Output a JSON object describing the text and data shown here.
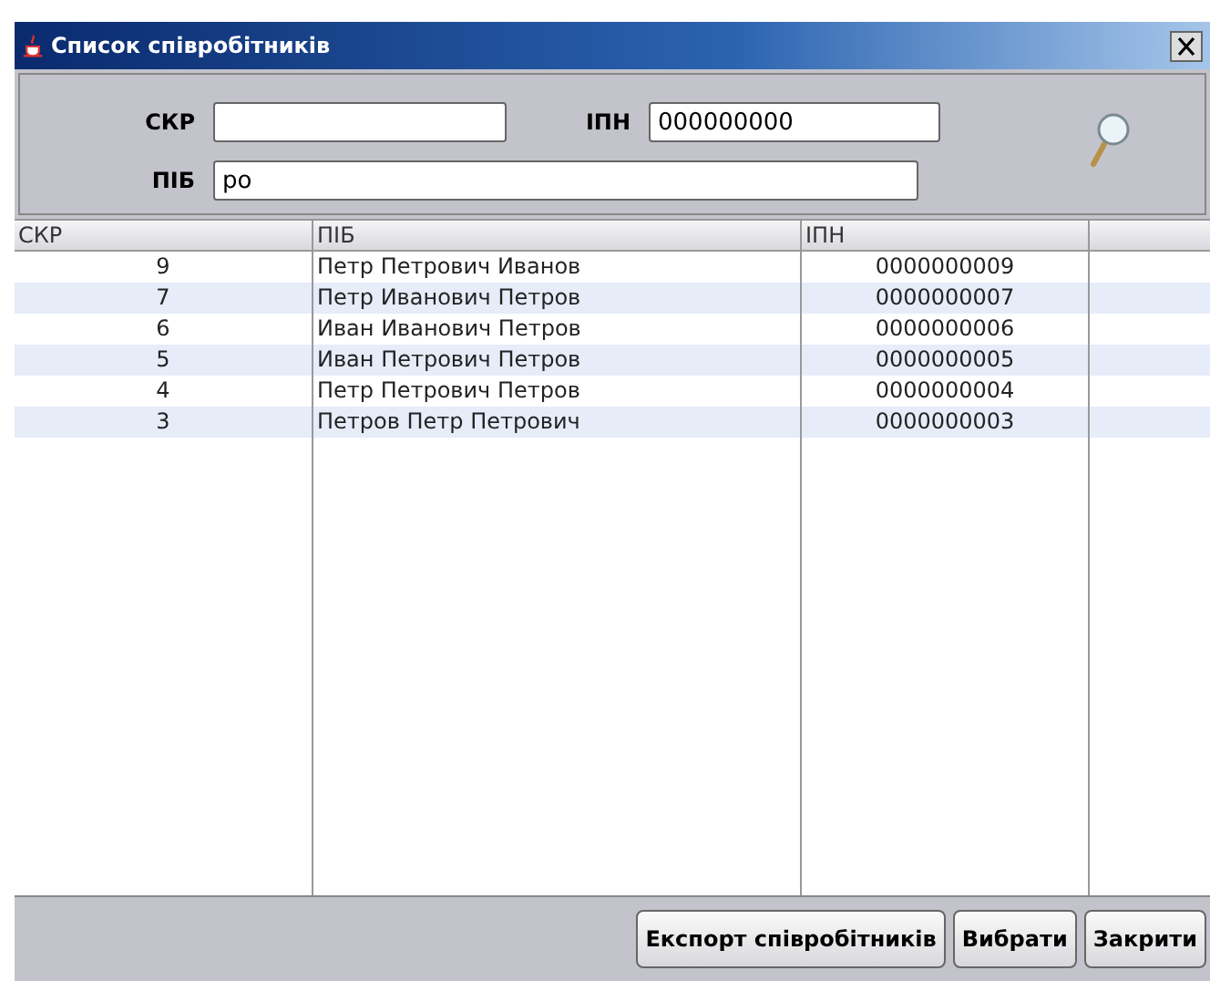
{
  "window": {
    "title": "Список співробітників"
  },
  "form": {
    "fields": [
      {
        "label": "СКР"
      },
      {
        "label": "ІПН",
        "value": "000000000"
      },
      {
        "label": "ПІБ",
        "value": "ро"
      }
    ]
  },
  "table": {
    "columns": [
      "СКР",
      "ПІБ",
      "ІПН"
    ],
    "rows": [
      [
        "9",
        "Петр Петрович Иванов",
        "0000000009"
      ],
      [
        "7",
        "Петр Иванович Петров",
        "0000000007"
      ],
      [
        "6",
        "Иван Иванович Петров",
        "0000000006"
      ],
      [
        "5",
        "Иван Петрович Петров",
        "0000000005"
      ],
      [
        "4",
        "Петр Петрович Петров",
        "0000000004"
      ],
      [
        "3",
        "Петров Петр Петрович",
        "0000000003"
      ]
    ]
  },
  "buttons": [
    "Експорт співробітників",
    "Вибрати",
    "Закрити"
  ]
}
